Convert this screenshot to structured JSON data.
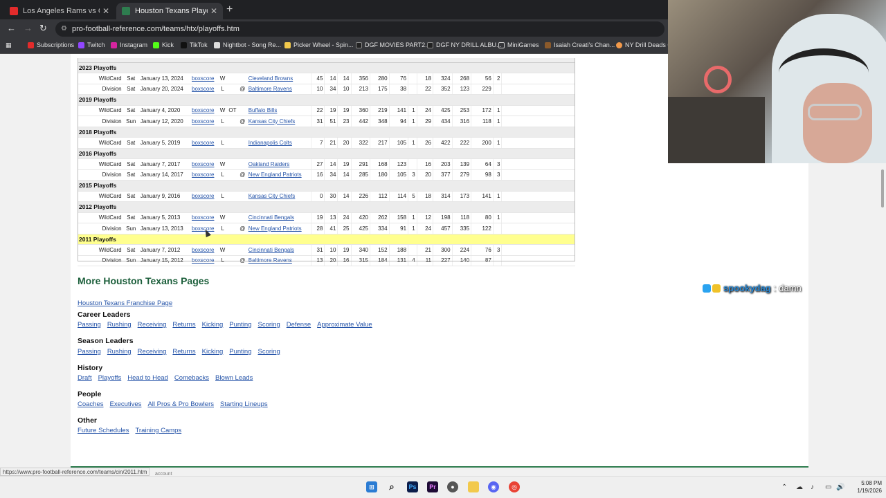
{
  "browser": {
    "tabs": [
      {
        "title": "Los Angeles Rams vs Chicago B",
        "favicon_color": "#e32b2b",
        "active": false
      },
      {
        "title": "Houston Texans Playoff History",
        "favicon_color": "#2e7d4f",
        "active": true
      }
    ],
    "url": "pro-football-reference.com/teams/htx/playoffs.htm",
    "bookmarks": [
      {
        "label": "Subscriptions",
        "icon_color": "#e32b2b"
      },
      {
        "label": "Twitch",
        "icon_color": "#9146ff"
      },
      {
        "label": "Instagram",
        "icon_color": "#d6249f"
      },
      {
        "label": "Kick",
        "icon_color": "#53fc18"
      },
      {
        "label": "TikTok",
        "icon_color": "#111111"
      },
      {
        "label": "Nightbot - Song Re...",
        "icon_color": "#dddddd"
      },
      {
        "label": "Picker Wheel - Spin...",
        "icon_color": "#f2c94c"
      },
      {
        "label": "DGF MOVIES PART2...",
        "icon_color": "#222222"
      },
      {
        "label": "DGF NY DRILL ALBU...",
        "icon_color": "#222222"
      },
      {
        "label": "MiniGames",
        "icon_color": "#cccccc"
      },
      {
        "label": "Isaiah Creati's Chan...",
        "icon_color": "#8b5a2b"
      },
      {
        "label": "NY Drill Deads Q",
        "icon_color": "#f2994a"
      }
    ]
  },
  "playoffs_table": {
    "sections": [
      {
        "header": "2023 Playoffs",
        "highlight": false,
        "games": [
          {
            "round": "WildCard",
            "day": "Sat",
            "date": "January 13, 2024",
            "box": "boxscore",
            "result": "W",
            "ot": "",
            "at": "",
            "opp": "Cleveland Browns",
            "c1": "45",
            "c2": "14",
            "c3": "14",
            "c4": "356",
            "c5": "280",
            "c6": "76",
            "c7": "",
            "c8": "18",
            "c9": "324",
            "c10": "268",
            "c11": "56",
            "c12": "2"
          },
          {
            "round": "Division",
            "day": "Sat",
            "date": "January 20, 2024",
            "box": "boxscore",
            "result": "L",
            "ot": "",
            "at": "@",
            "opp": "Baltimore Ravens",
            "c1": "10",
            "c2": "34",
            "c3": "10",
            "c4": "213",
            "c5": "175",
            "c6": "38",
            "c7": "",
            "c8": "22",
            "c9": "352",
            "c10": "123",
            "c11": "229",
            "c12": ""
          }
        ]
      },
      {
        "header": "2019 Playoffs",
        "highlight": false,
        "games": [
          {
            "round": "WildCard",
            "day": "Sat",
            "date": "January 4, 2020",
            "box": "boxscore",
            "result": "W",
            "ot": "OT",
            "at": "",
            "opp": "Buffalo Bills",
            "c1": "22",
            "c2": "19",
            "c3": "19",
            "c4": "360",
            "c5": "219",
            "c6": "141",
            "c7": "1",
            "c8": "24",
            "c9": "425",
            "c10": "253",
            "c11": "172",
            "c12": "1"
          },
          {
            "round": "Division",
            "day": "Sun",
            "date": "January 12, 2020",
            "box": "boxscore",
            "result": "L",
            "ot": "",
            "at": "@",
            "opp": "Kansas City Chiefs",
            "c1": "31",
            "c2": "51",
            "c3": "23",
            "c4": "442",
            "c5": "348",
            "c6": "94",
            "c7": "1",
            "c8": "29",
            "c9": "434",
            "c10": "316",
            "c11": "118",
            "c12": "1"
          }
        ]
      },
      {
        "header": "2018 Playoffs",
        "highlight": false,
        "games": [
          {
            "round": "WildCard",
            "day": "Sat",
            "date": "January 5, 2019",
            "box": "boxscore",
            "result": "L",
            "ot": "",
            "at": "",
            "opp": "Indianapolis Colts",
            "c1": "7",
            "c2": "21",
            "c3": "20",
            "c4": "322",
            "c5": "217",
            "c6": "105",
            "c7": "1",
            "c8": "26",
            "c9": "422",
            "c10": "222",
            "c11": "200",
            "c12": "1"
          }
        ]
      },
      {
        "header": "2016 Playoffs",
        "highlight": false,
        "games": [
          {
            "round": "WildCard",
            "day": "Sat",
            "date": "January 7, 2017",
            "box": "boxscore",
            "result": "W",
            "ot": "",
            "at": "",
            "opp": "Oakland Raiders",
            "c1": "27",
            "c2": "14",
            "c3": "19",
            "c4": "291",
            "c5": "168",
            "c6": "123",
            "c7": "",
            "c8": "16",
            "c9": "203",
            "c10": "139",
            "c11": "64",
            "c12": "3"
          },
          {
            "round": "Division",
            "day": "Sat",
            "date": "January 14, 2017",
            "box": "boxscore",
            "result": "L",
            "ot": "",
            "at": "@",
            "opp": "New England Patriots",
            "c1": "16",
            "c2": "34",
            "c3": "14",
            "c4": "285",
            "c5": "180",
            "c6": "105",
            "c7": "3",
            "c8": "20",
            "c9": "377",
            "c10": "279",
            "c11": "98",
            "c12": "3"
          }
        ]
      },
      {
        "header": "2015 Playoffs",
        "highlight": false,
        "games": [
          {
            "round": "WildCard",
            "day": "Sat",
            "date": "January 9, 2016",
            "box": "boxscore",
            "result": "L",
            "ot": "",
            "at": "",
            "opp": "Kansas City Chiefs",
            "c1": "0",
            "c2": "30",
            "c3": "14",
            "c4": "226",
            "c5": "112",
            "c6": "114",
            "c7": "5",
            "c8": "18",
            "c9": "314",
            "c10": "173",
            "c11": "141",
            "c12": "1"
          }
        ]
      },
      {
        "header": "2012 Playoffs",
        "highlight": false,
        "games": [
          {
            "round": "WildCard",
            "day": "Sat",
            "date": "January 5, 2013",
            "box": "boxscore",
            "result": "W",
            "ot": "",
            "at": "",
            "opp": "Cincinnati Bengals",
            "c1": "19",
            "c2": "13",
            "c3": "24",
            "c4": "420",
            "c5": "262",
            "c6": "158",
            "c7": "1",
            "c8": "12",
            "c9": "198",
            "c10": "118",
            "c11": "80",
            "c12": "1"
          },
          {
            "round": "Division",
            "day": "Sun",
            "date": "January 13, 2013",
            "box": "boxscore",
            "result": "L",
            "ot": "",
            "at": "@",
            "opp": "New England Patriots",
            "c1": "28",
            "c2": "41",
            "c3": "25",
            "c4": "425",
            "c5": "334",
            "c6": "91",
            "c7": "1",
            "c8": "24",
            "c9": "457",
            "c10": "335",
            "c11": "122",
            "c12": ""
          }
        ]
      },
      {
        "header": "2011 Playoffs",
        "highlight": true,
        "games": [
          {
            "round": "WildCard",
            "day": "Sat",
            "date": "January 7, 2012",
            "box": "boxscore",
            "result": "W",
            "ot": "",
            "at": "",
            "opp": "Cincinnati Bengals",
            "c1": "31",
            "c2": "10",
            "c3": "19",
            "c4": "340",
            "c5": "152",
            "c6": "188",
            "c7": "",
            "c8": "21",
            "c9": "300",
            "c10": "224",
            "c11": "76",
            "c12": "3"
          },
          {
            "round": "Division",
            "day": "Sun",
            "date": "January 15, 2012",
            "box": "boxscore",
            "result": "L",
            "ot": "",
            "at": "@",
            "opp": "Baltimore Ravens",
            "c1": "13",
            "c2": "20",
            "c3": "16",
            "c4": "315",
            "c5": "184",
            "c6": "131",
            "c7": "4",
            "c8": "11",
            "c9": "227",
            "c10": "140",
            "c11": "87",
            "c12": ""
          }
        ]
      }
    ]
  },
  "more_pages": {
    "title": "More Houston Texans Pages",
    "franchise_link": "Houston Texans Franchise Page",
    "groups": [
      {
        "title": "Career Leaders",
        "links": [
          "Passing",
          "Rushing",
          "Receiving",
          "Returns",
          "Kicking",
          "Punting",
          "Scoring",
          "Defense",
          "Approximate Value"
        ]
      },
      {
        "title": "Season Leaders",
        "links": [
          "Passing",
          "Rushing",
          "Receiving",
          "Returns",
          "Kicking",
          "Punting",
          "Scoring"
        ]
      },
      {
        "title": "History",
        "links": [
          "Draft",
          "Playoffs",
          "Head to Head",
          "Comebacks",
          "Blown Leads"
        ]
      },
      {
        "title": "People",
        "links": [
          "Coaches",
          "Executives",
          "All Pros & Pro Bowlers",
          "Starting Lineups"
        ]
      },
      {
        "title": "Other",
        "links": [
          "Future Schedules",
          "Training Camps"
        ]
      }
    ]
  },
  "status_url": "https://www.pro-football-reference.com/teams/cin/2011.htm",
  "chat_overlay": {
    "user": "spookydag",
    "separator": ":",
    "message": "damn"
  },
  "taskbar": {
    "time": "5:08 PM",
    "date": "1/19/2026"
  }
}
